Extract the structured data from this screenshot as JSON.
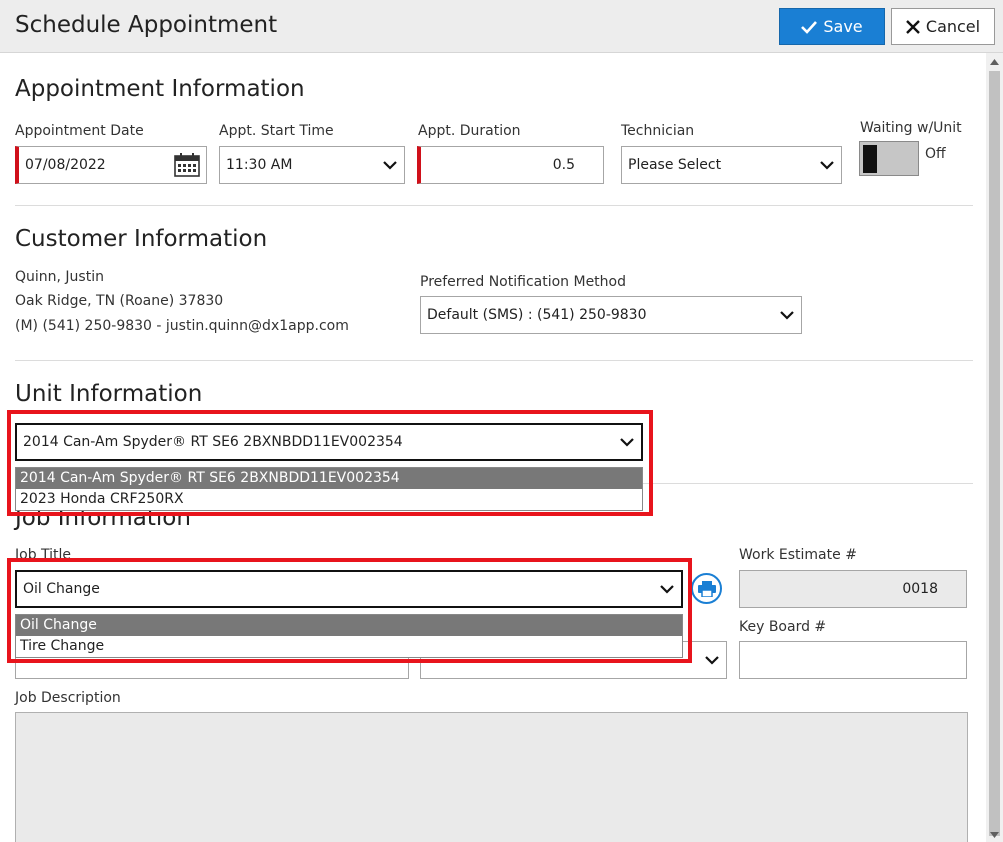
{
  "window": {
    "title": "Schedule Appointment",
    "save_label": "Save",
    "cancel_label": "Cancel"
  },
  "appointment": {
    "section_title": "Appointment Information",
    "date_label": "Appointment Date",
    "date_value": "07/08/2022",
    "start_label": "Appt. Start Time",
    "start_value": "11:30 AM",
    "duration_label": "Appt. Duration",
    "duration_value": "0.5",
    "tech_label": "Technician",
    "tech_value": "Please Select",
    "waiting_label": "Waiting w/Unit",
    "waiting_state": "Off"
  },
  "customer": {
    "section_title": "Customer Information",
    "name": "Quinn, Justin",
    "address": "Oak Ridge, TN (Roane) 37830",
    "contact": "(M) (541) 250-9830 - justin.quinn@dx1app.com",
    "notif_label": "Preferred Notification Method",
    "notif_value": "Default (SMS) : (541) 250-9830"
  },
  "unit": {
    "section_title": "Unit Information",
    "selected": "2014 Can-Am Spyder® RT SE6 2BXNBDD11EV002354",
    "options": [
      "2014 Can-Am Spyder® RT SE6 2BXNBDD11EV002354",
      "2023 Honda CRF250RX"
    ]
  },
  "job": {
    "section_title": "Job Information",
    "title_label": "Job Title",
    "title_value": "Oil Change",
    "options": [
      "Oil Change",
      "Tire Change"
    ],
    "estimate_label": "Work Estimate #",
    "estimate_value": "0018",
    "keyboard_label": "Key Board #",
    "keyboard_value": "",
    "desc_label": "Job Description"
  },
  "colors": {
    "accent": "#1a7fd4",
    "required": "#d0101a",
    "highlight": "#e8141c"
  },
  "icons": {
    "save": "check-icon",
    "cancel": "close-icon",
    "date": "calendar-icon",
    "dropdown": "chevron-down-icon",
    "print": "print-icon"
  }
}
